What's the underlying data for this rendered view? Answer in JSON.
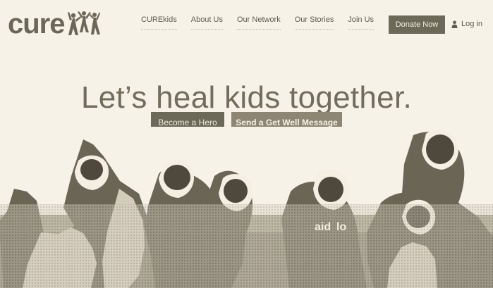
{
  "brand": {
    "logo_text": "cure"
  },
  "nav": {
    "items": [
      {
        "label": "CUREkids"
      },
      {
        "label": "About Us"
      },
      {
        "label": "Our Network"
      },
      {
        "label": "Our Stories"
      },
      {
        "label": "Join Us"
      }
    ]
  },
  "header": {
    "donate_label": "Donate Now",
    "login_label": "Log in"
  },
  "hero": {
    "headline": "Let’s heal kids together.",
    "primary_cta": "Become a Hero",
    "secondary_cta": "Send a Get Well Message"
  },
  "icons": {
    "user_icon": "user-icon",
    "logo_figures": "children-figures-icon"
  },
  "colors": {
    "background": "#f6f2e8",
    "primary_button": "#6d6959",
    "secondary_button": "#8c8672",
    "text": "#716c5c"
  }
}
